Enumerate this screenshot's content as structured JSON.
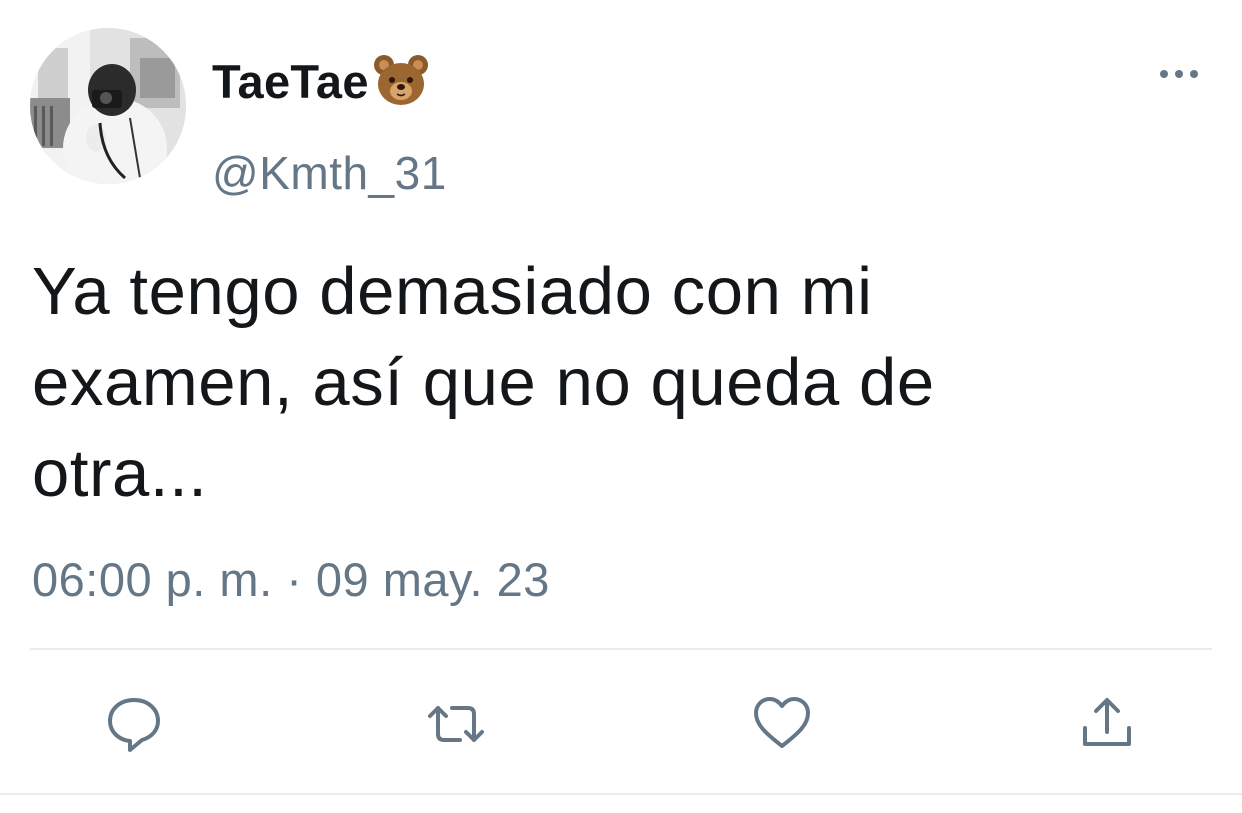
{
  "tweet": {
    "display_name": "TaeTae",
    "display_name_emoji": "bear-face-emoji",
    "handle": "@Kmth_31",
    "text": "Ya tengo demasiado con mi\nexamen, así que no queda de\notra...",
    "timestamp": "06:00 p. m. · 09 may. 23"
  },
  "actions": {
    "reply_icon": "reply-icon",
    "retweet_icon": "retweet-icon",
    "like_icon": "heart-icon",
    "share_icon": "share-icon",
    "more_icon": "more-options-icon"
  },
  "colors": {
    "text_primary": "#14171a",
    "text_secondary": "#657786",
    "divider": "#e6ecf0",
    "background": "#ffffff"
  }
}
